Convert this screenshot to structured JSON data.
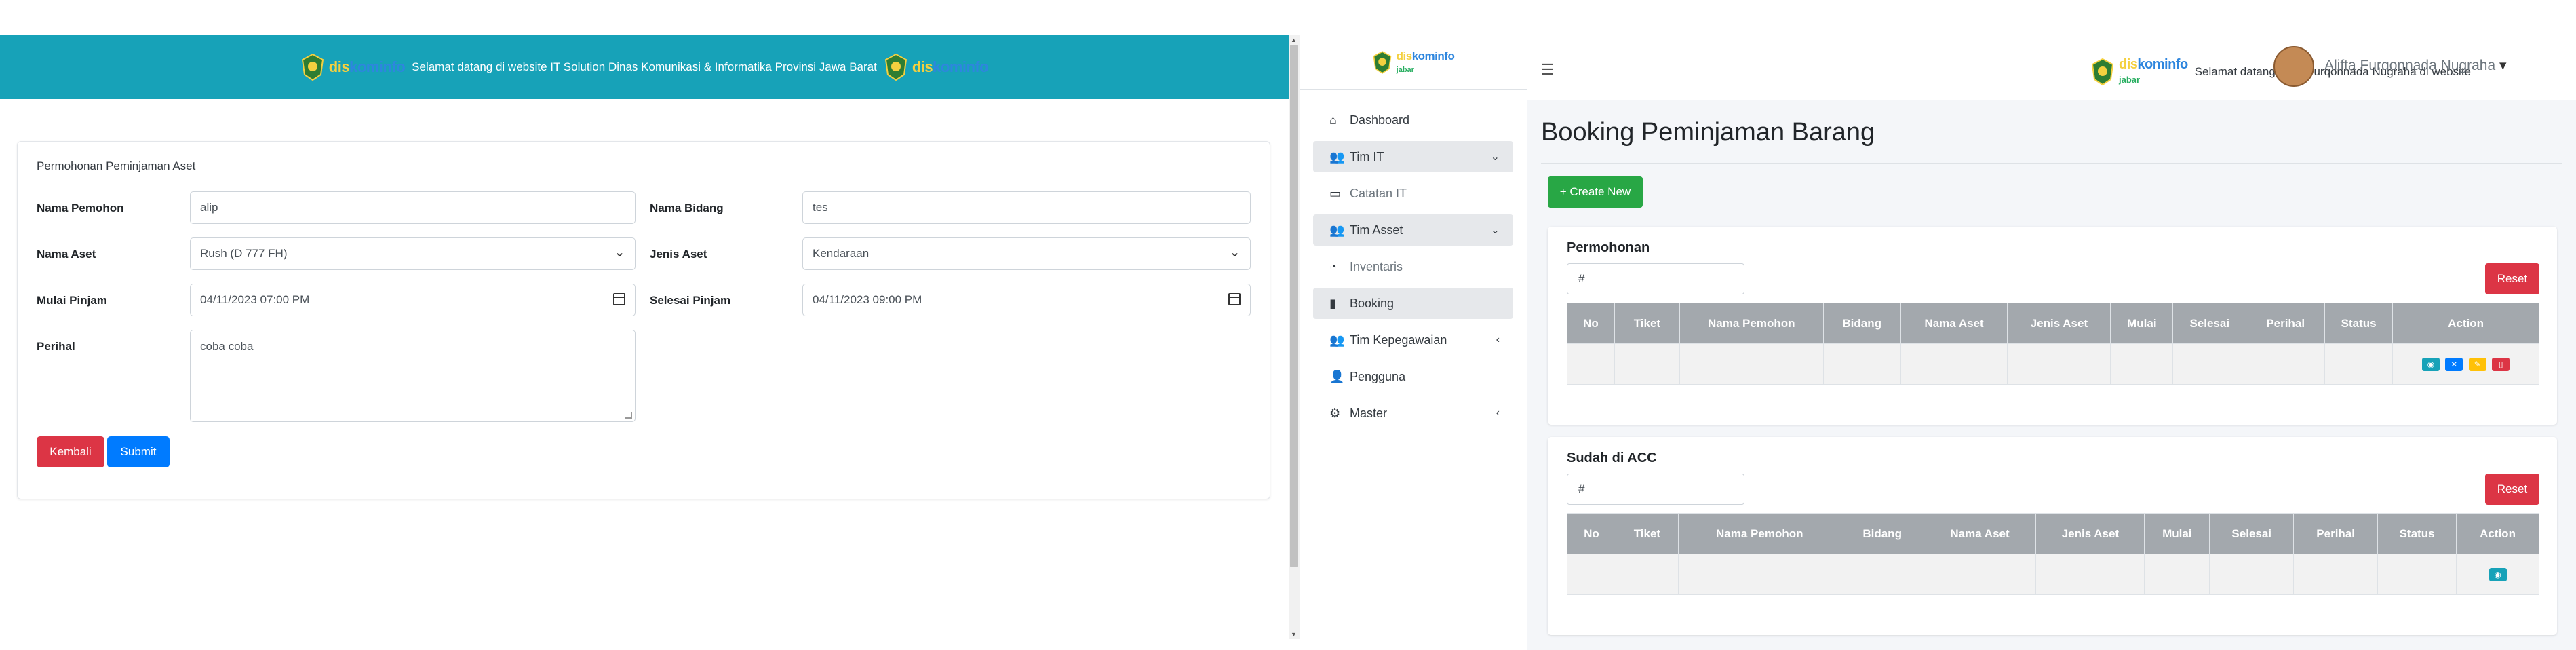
{
  "left": {
    "banner_text": "Selamat datang di website IT Solution Dinas Komunikasi & Informatika Provinsi Jawa Barat",
    "logo_w1": "dis",
    "logo_w2": "kominfo",
    "form": {
      "title": "Permohonan Peminjaman Aset",
      "nama_pemohon_label": "Nama Pemohon",
      "nama_pemohon_value": "alip",
      "nama_bidang_label": "Nama Bidang",
      "nama_bidang_value": "tes",
      "nama_aset_label": "Nama Aset",
      "nama_aset_value": "Rush (D 777 FH)",
      "jenis_aset_label": "Jenis Aset",
      "jenis_aset_value": "Kendaraan",
      "mulai_label": "Mulai Pinjam",
      "mulai_value": "04/11/2023 07:00 PM",
      "selesai_label": "Selesai Pinjam",
      "selesai_value": "04/11/2023 09:00 PM",
      "perihal_label": "Perihal",
      "perihal_value": "coba coba",
      "kembali": "Kembali",
      "submit": "Submit"
    }
  },
  "right": {
    "logo_w1": "dis",
    "logo_w2": "kominfo",
    "logo_sub": "jabar",
    "welcome": "Selamat datang Alifta Furqonnada Nugraha di website",
    "user_name": "Alifta Furqonnada Nugraha",
    "sidebar": {
      "items": [
        {
          "label": "Dashboard"
        },
        {
          "label": "Tim IT"
        },
        {
          "label": "Catatan IT"
        },
        {
          "label": "Tim Asset"
        },
        {
          "label": "Inventaris"
        },
        {
          "label": "Booking"
        },
        {
          "label": "Tim Kepegawaian"
        },
        {
          "label": "Pengguna"
        },
        {
          "label": "Master"
        }
      ]
    },
    "page_title": "Booking Peminjaman Barang",
    "create_new": "+ Create New",
    "columns": [
      "No",
      "Tiket",
      "Nama Pemohon",
      "Bidang",
      "Nama Aset",
      "Jenis Aset",
      "Mulai",
      "Selesai",
      "Perihal",
      "Status",
      "Action"
    ],
    "card1": {
      "title": "Permohonan",
      "search_value": "#",
      "reset": "Reset"
    },
    "card2": {
      "title": "Sudah di ACC",
      "search_value": "#",
      "reset": "Reset"
    }
  },
  "colors": {
    "banner": "#17a2b8",
    "danger": "#dc3545",
    "primary": "#007bff",
    "success": "#28a745",
    "table_header": "#a3a8ad"
  }
}
